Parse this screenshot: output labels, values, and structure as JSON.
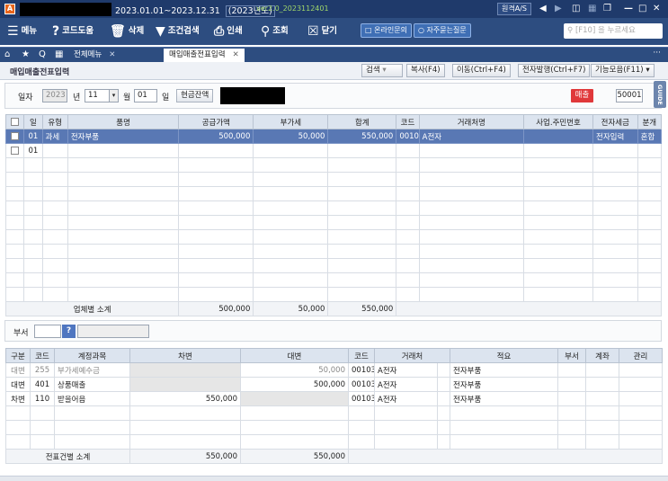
{
  "titlebar": {
    "app_icon": "A",
    "period": "2023.01.01~2023.12.31",
    "fiscal_year": "(2023년도)",
    "version": "ver2.0_2023112401",
    "remote_support": "원격A/S",
    "icons": [
      "arrow-left-icon",
      "arrow-right-icon",
      "book-icon",
      "grid-icon",
      "window-icon",
      "minimize-icon",
      "maximize-icon",
      "close-icon"
    ]
  },
  "toolbar": {
    "menu": "메뉴",
    "help": "코드도움",
    "delete": "삭제",
    "condition_search": "조건검색",
    "print": "인쇄",
    "lookup": "조회",
    "close": "닫기",
    "online_inquiry": "온라인문의",
    "faq": "자주묻는질문",
    "search_placeholder": "[F10] 을 누르세요"
  },
  "tabs": {
    "all_menu": "전체메뉴",
    "active": "매입매출전표입력",
    "close_glyph": "✕",
    "more": "···"
  },
  "form": {
    "title": "매입매출전표입력",
    "buttons": {
      "search": "검색",
      "copy": "복사(F4)",
      "move": "이동(Ctrl+F4)",
      "e_issue": "전자발행(Ctrl+F7)",
      "features": "기능모음(F11)"
    }
  },
  "filter": {
    "date_label": "일자",
    "year": "2023",
    "year_unit": "년",
    "month": "11",
    "month_unit": "월",
    "day": "01",
    "day_unit": "일",
    "cash_balance": "현금잔액",
    "sales_badge": "매출",
    "code": "50001",
    "guide": "GUIDE"
  },
  "grid1": {
    "headers": [
      "일",
      "유형",
      "품명",
      "공급가액",
      "부가세",
      "합계",
      "코드",
      "거래처명",
      "사업.주민번호",
      "전자세금",
      "분개"
    ],
    "rows": [
      {
        "day": "01",
        "type": "과세",
        "item": "전자부품",
        "supply": "500,000",
        "vat": "50,000",
        "total": "550,000",
        "code": "00103",
        "partner": "A전자",
        "bizno": "",
        "etax": "전자입력",
        "journal": "혼합"
      },
      {
        "day": "01",
        "type": "",
        "item": "",
        "supply": "",
        "vat": "",
        "total": "",
        "code": "",
        "partner": "",
        "bizno": "",
        "etax": "",
        "journal": ""
      }
    ],
    "subtotal_label": "업체별 소계",
    "subtotal_supply": "500,000",
    "subtotal_vat": "50,000",
    "subtotal_total": "550,000"
  },
  "dept": {
    "label": "부서",
    "help": "?"
  },
  "grid2": {
    "headers": [
      "구분",
      "코드",
      "계정과목",
      "차변",
      "대변",
      "코드",
      "거래처",
      "적요",
      "부서",
      "계좌",
      "관리"
    ],
    "rows": [
      {
        "div": "대변",
        "code": "255",
        "account": "부가세예수금",
        "debit": "",
        "credit": "50,000",
        "pcode": "00103",
        "partner": "A전자",
        "memo": "전자부품",
        "muted": true
      },
      {
        "div": "대변",
        "code": "401",
        "account": "상품매출",
        "debit": "",
        "credit": "500,000",
        "pcode": "00103",
        "partner": "A전자",
        "memo": "전자부품",
        "muted": false
      },
      {
        "div": "차변",
        "code": "110",
        "account": "받을어음",
        "debit": "550,000",
        "credit": "",
        "pcode": "00103",
        "partner": "A전자",
        "memo": "전자부품",
        "muted": false
      }
    ],
    "subtotal_label": "전표건별 소계",
    "subtotal_debit": "550,000",
    "subtotal_credit": "550,000"
  }
}
